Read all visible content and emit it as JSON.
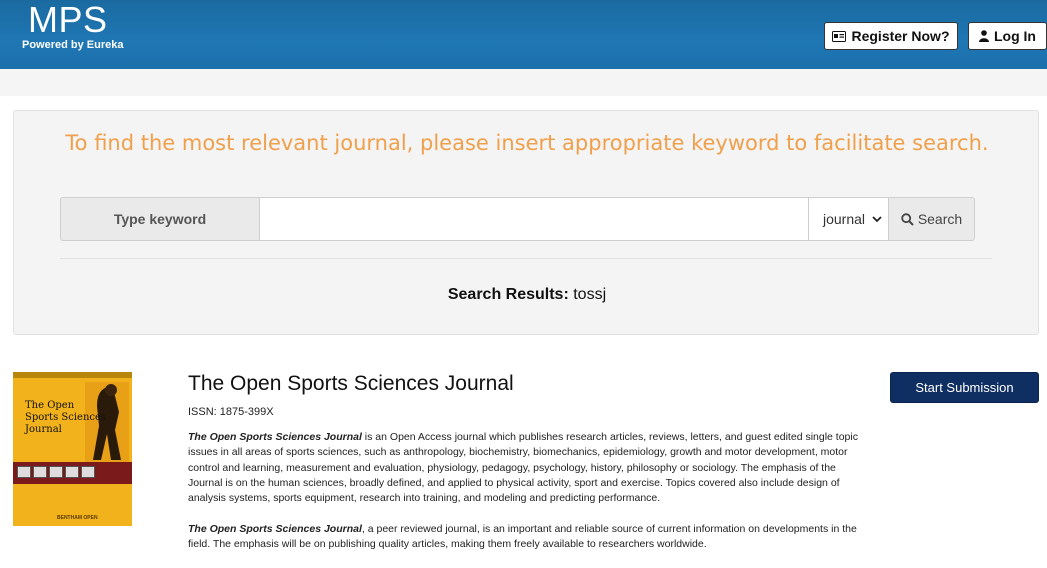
{
  "header": {
    "brand_title": "MPS",
    "brand_subtitle": "Powered by Eureka",
    "register_label": "Register Now?",
    "login_label": "Log In"
  },
  "search": {
    "tagline": "To find the most relevant journal, please insert appropriate keyword to facilitate search.",
    "keyword_label": "Type keyword",
    "input_value": "",
    "type_selected": "journal",
    "search_label": "Search",
    "results_label": "Search Results:",
    "results_query": "tossj"
  },
  "journal": {
    "cover_title_1": "The Open",
    "cover_title_2": "Sports Sciences",
    "cover_title_3": "Journal",
    "cover_publisher": "BENTHAM OPEN",
    "title": "The Open Sports Sciences Journal",
    "issn": "ISSN: 1875-399X",
    "desc1_name": "The Open Sports Sciences Journal",
    "desc1_text": " is an Open Access journal which publishes research articles, reviews, letters, and guest edited single topic issues in all areas of sports sciences, such as anthropology, biochemistry, biomechanics, epidemiology, growth and motor development, motor control and learning, measurement and evaluation, physiology, pedagogy, psychology, history, philosophy or sociology. The emphasis of the Journal is on the human sciences, broadly defined, and applied to physical activity, sport and exercise. Topics covered also include design of analysis systems, sports equipment, research into training, and modeling and predicting performance.",
    "desc2_name": "The Open Sports Sciences Journal",
    "desc2_text": ", a peer reviewed journal, is an important and reliable source of current information on developments in the field. The emphasis will be on publishing quality articles, making them freely available to researchers worldwide.",
    "submit_label": "Start Submission"
  },
  "colors": {
    "header_blue": "#1f77b4",
    "tagline_orange": "#f0a04b",
    "submit_navy": "#0f2f63",
    "cover_yellow": "#f2b21c"
  }
}
